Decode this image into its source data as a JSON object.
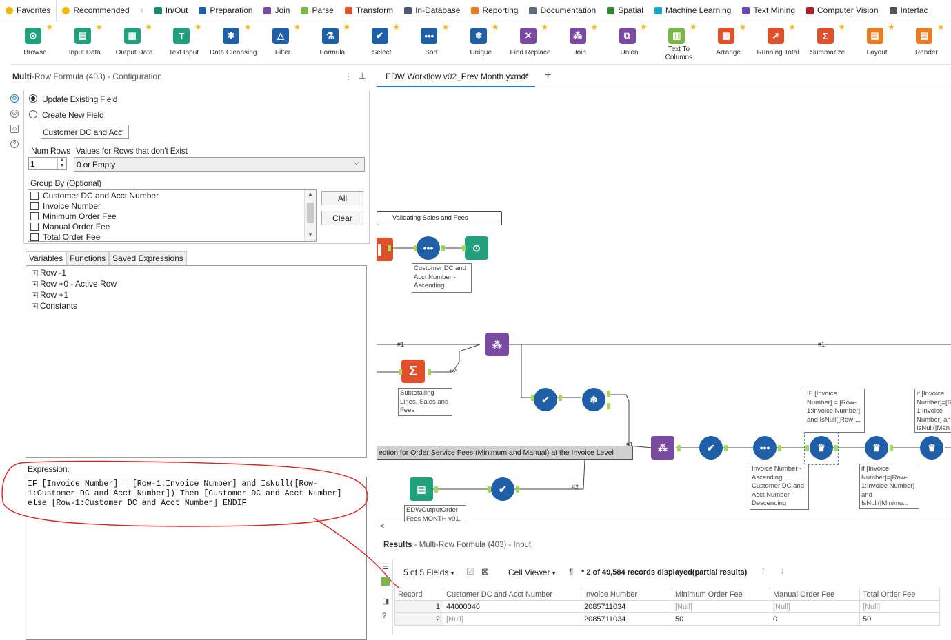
{
  "categories": [
    {
      "label": "Favorites",
      "color": "#f2b705",
      "icon": "star-icon"
    },
    {
      "label": "Recommended",
      "color": "#f2b705",
      "icon": "sun-icon"
    },
    {
      "label": "In/Out",
      "color": "#1a8a6e",
      "icon": "folder-icon"
    },
    {
      "label": "Preparation",
      "color": "#1f5fa8",
      "icon": "circle-icon"
    },
    {
      "label": "Join",
      "color": "#7a4aa3",
      "icon": "square-icon"
    },
    {
      "label": "Parse",
      "color": "#7ab648",
      "icon": "hex-icon"
    },
    {
      "label": "Transform",
      "color": "#e0502a",
      "icon": "transform-icon"
    },
    {
      "label": "In-Database",
      "color": "#4b5a72",
      "icon": "database-icon"
    },
    {
      "label": "Reporting",
      "color": "#e97b23",
      "icon": "report-icon"
    },
    {
      "label": "Documentation",
      "color": "#5b6b80",
      "icon": "comment-icon"
    },
    {
      "label": "Spatial",
      "color": "#2f8a2f",
      "icon": "gear-icon"
    },
    {
      "label": "Machine Learning",
      "color": "#18a6c9",
      "icon": "ml-icon"
    },
    {
      "label": "Text Mining",
      "color": "#6b46b5",
      "icon": "text-mining-icon"
    },
    {
      "label": "Computer Vision",
      "color": "#b0202a",
      "icon": "vision-icon"
    },
    {
      "label": "Interfac",
      "color": "#555555",
      "icon": "interface-icon"
    }
  ],
  "tools": [
    {
      "label": "Browse",
      "color": "#20a07c",
      "glyph": "⊙"
    },
    {
      "label": "Input Data",
      "color": "#20a07c",
      "glyph": "▤"
    },
    {
      "label": "Output Data",
      "color": "#20a07c",
      "glyph": "▦"
    },
    {
      "label": "Text Input",
      "color": "#20a07c",
      "glyph": "T"
    },
    {
      "label": "Data Cleansing",
      "color": "#1f5fa8",
      "glyph": "✱"
    },
    {
      "label": "Filter",
      "color": "#1f5fa8",
      "glyph": "△"
    },
    {
      "label": "Formula",
      "color": "#1f5fa8",
      "glyph": "⚗"
    },
    {
      "label": "Select",
      "color": "#1f5fa8",
      "glyph": "✔"
    },
    {
      "label": "Sort",
      "color": "#1f5fa8",
      "glyph": "•••"
    },
    {
      "label": "Unique",
      "color": "#1f5fa8",
      "glyph": "❄"
    },
    {
      "label": "Find Replace",
      "color": "#7a4aa3",
      "glyph": "✕"
    },
    {
      "label": "Join",
      "color": "#7a4aa3",
      "glyph": "⁂"
    },
    {
      "label": "Union",
      "color": "#7a4aa3",
      "glyph": "⧉"
    },
    {
      "label": "Text To Columns",
      "color": "#7ab648",
      "glyph": "▥"
    },
    {
      "label": "Arrange",
      "color": "#e0502a",
      "glyph": "▦"
    },
    {
      "label": "Running Total",
      "color": "#e0502a",
      "glyph": "➚"
    },
    {
      "label": "Summarize",
      "color": "#e0502a",
      "glyph": "Σ"
    },
    {
      "label": "Layout",
      "color": "#e97b23",
      "glyph": "▤"
    },
    {
      "label": "Render",
      "color": "#e97b23",
      "glyph": "▤"
    }
  ],
  "config": {
    "title_bold": "Multi",
    "title_rest": "-Row Formula (403) - Configuration",
    "update_existing": "Update Existing Field",
    "create_new": "Create New  Field",
    "field_select": "Customer DC and Acc",
    "num_rows_label": "Num Rows",
    "num_rows_value": "1",
    "values_label": "Values for Rows that don't Exist",
    "values_select": "0 or Empty",
    "group_by_label": "Group By (Optional)",
    "group_fields": [
      "Customer DC and Acct Number",
      "Invoice Number",
      "Minimum Order Fee",
      "Manual Order Fee",
      "Total Order Fee"
    ],
    "all_btn": "All",
    "clear_btn": "Clear",
    "tabs": [
      "Variables",
      "Functions",
      "Saved Expressions"
    ],
    "tree": [
      "Row -1",
      "Row +0 - Active Row",
      "Row +1",
      "Constants"
    ],
    "expression_label": "Expression:",
    "expression": "IF [Invoice Number] = [Row-1:Invoice Number] and IsNull([Row-\n1:Customer DC and Acct Number]) Then [Customer DC and Acct Number]\nelse [Row-1:Customer DC and Acct Number] ENDIF"
  },
  "workflow": {
    "tab_title": "EDW Workflow v02_Prev Month.yxmd*",
    "tab_close": "×",
    "tab_add": "+",
    "container_1": "Validating Sales and Fees",
    "container_2": "ection for Order Service Fees (Minimum and Manual) at the Invoice Level",
    "ann_sort1": "Customer DC and Acct Number - Ascending",
    "ann_summ": "Subtotalling Lines, Sales and Fees",
    "ann_sort2": "Invoice Number - Ascending Customer DC and Acct Number - Descending",
    "ann_mr1": "IF [Invoice Number] = [Row-1:Invoice Number] and IsNull([Row-...",
    "ann_mr2": "if [Invoice Number]=[Row-1:Invoice Number] and IsNull([Minimu...",
    "ann_mr3": "if [Invoice Number]=[R 1:Invoice Number] an IsNull([Man",
    "ann_out": "EDWOutputOrder Fees MONTH v01.",
    "conn_1": "#1",
    "conn_2": "#2",
    "conn_3": "#1",
    "conn_4": "#1",
    "conn_5": "#2",
    "scroll_left": "<"
  },
  "results": {
    "title_bold": "Results",
    "title_rest": " - Multi-Row Formula (403) - Input",
    "fields_label": "5 of 5 Fields",
    "cell_viewer": "Cell Viewer",
    "records_info": "* 2 of 49,584 records displayed(partial results)",
    "columns": [
      "Record",
      "Customer DC and Acct Number",
      "Invoice Number",
      "Minimum Order Fee",
      "Manual Order Fee",
      "Total Order Fee"
    ],
    "rows": [
      [
        "1",
        "44000046",
        "2085711034",
        "[Null]",
        "[Null]",
        "[Null]"
      ],
      [
        "2",
        "[Null]",
        "2085711034",
        "50",
        "0",
        "50"
      ]
    ]
  }
}
